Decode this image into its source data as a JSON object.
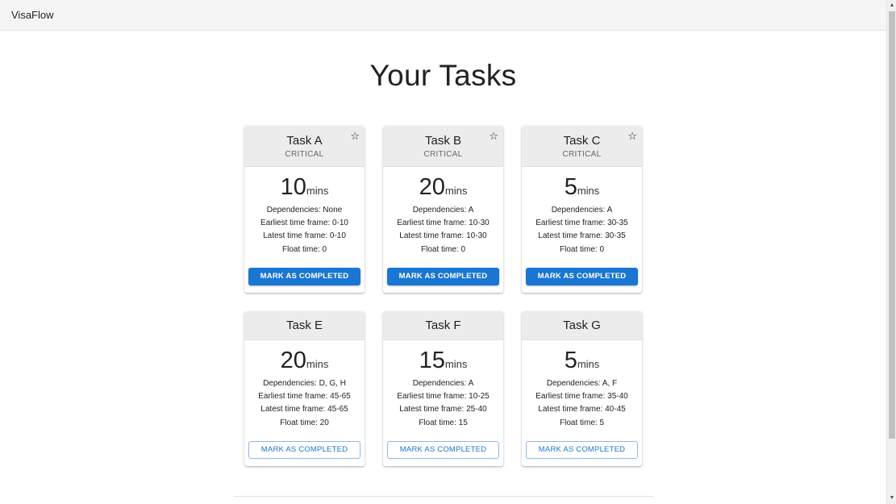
{
  "app": {
    "brand": "VisaFlow"
  },
  "page": {
    "title": "Your Tasks"
  },
  "labels": {
    "dur_unit": "mins",
    "dependencies": "Dependencies: ",
    "earliest": "Earliest time frame: ",
    "latest": "Latest time frame: ",
    "float": "Float time: "
  },
  "tasks": [
    {
      "name": "Task A",
      "tag": "CRITICAL",
      "starred": false,
      "duration": "10",
      "dependencies": "None",
      "earliest": "0-10",
      "latest": "0-10",
      "float": "0",
      "button": "MARK AS COMPLETED",
      "button_style": "filled"
    },
    {
      "name": "Task B",
      "tag": "CRITICAL",
      "starred": false,
      "duration": "20",
      "dependencies": "A",
      "earliest": "10-30",
      "latest": "10-30",
      "float": "0",
      "button": "MARK AS COMPLETED",
      "button_style": "filled"
    },
    {
      "name": "Task C",
      "tag": "CRITICAL",
      "starred": false,
      "duration": "5",
      "dependencies": "A",
      "earliest": "30-35",
      "latest": "30-35",
      "float": "0",
      "button": "MARK AS COMPLETED",
      "button_style": "filled"
    },
    {
      "name": "Task E",
      "tag": "",
      "duration": "20",
      "dependencies": "D, G, H",
      "earliest": "45-65",
      "latest": "45-65",
      "float": "20",
      "button": "MARK AS COMPLETED",
      "button_style": "outlined"
    },
    {
      "name": "Task F",
      "tag": "",
      "duration": "15",
      "dependencies": "A",
      "earliest": "10-25",
      "latest": "25-40",
      "float": "15",
      "button": "MARK AS COMPLETED",
      "button_style": "outlined"
    },
    {
      "name": "Task G",
      "tag": "",
      "duration": "5",
      "dependencies": "A, F",
      "earliest": "35-40",
      "latest": "40-45",
      "float": "5",
      "button": "MARK AS COMPLETED",
      "button_style": "outlined"
    }
  ],
  "icons": {
    "star": "star-outline-icon"
  },
  "colors": {
    "primary": "#1976d2",
    "header_bg": "#ececec",
    "appbar_bg": "#f5f5f5"
  }
}
